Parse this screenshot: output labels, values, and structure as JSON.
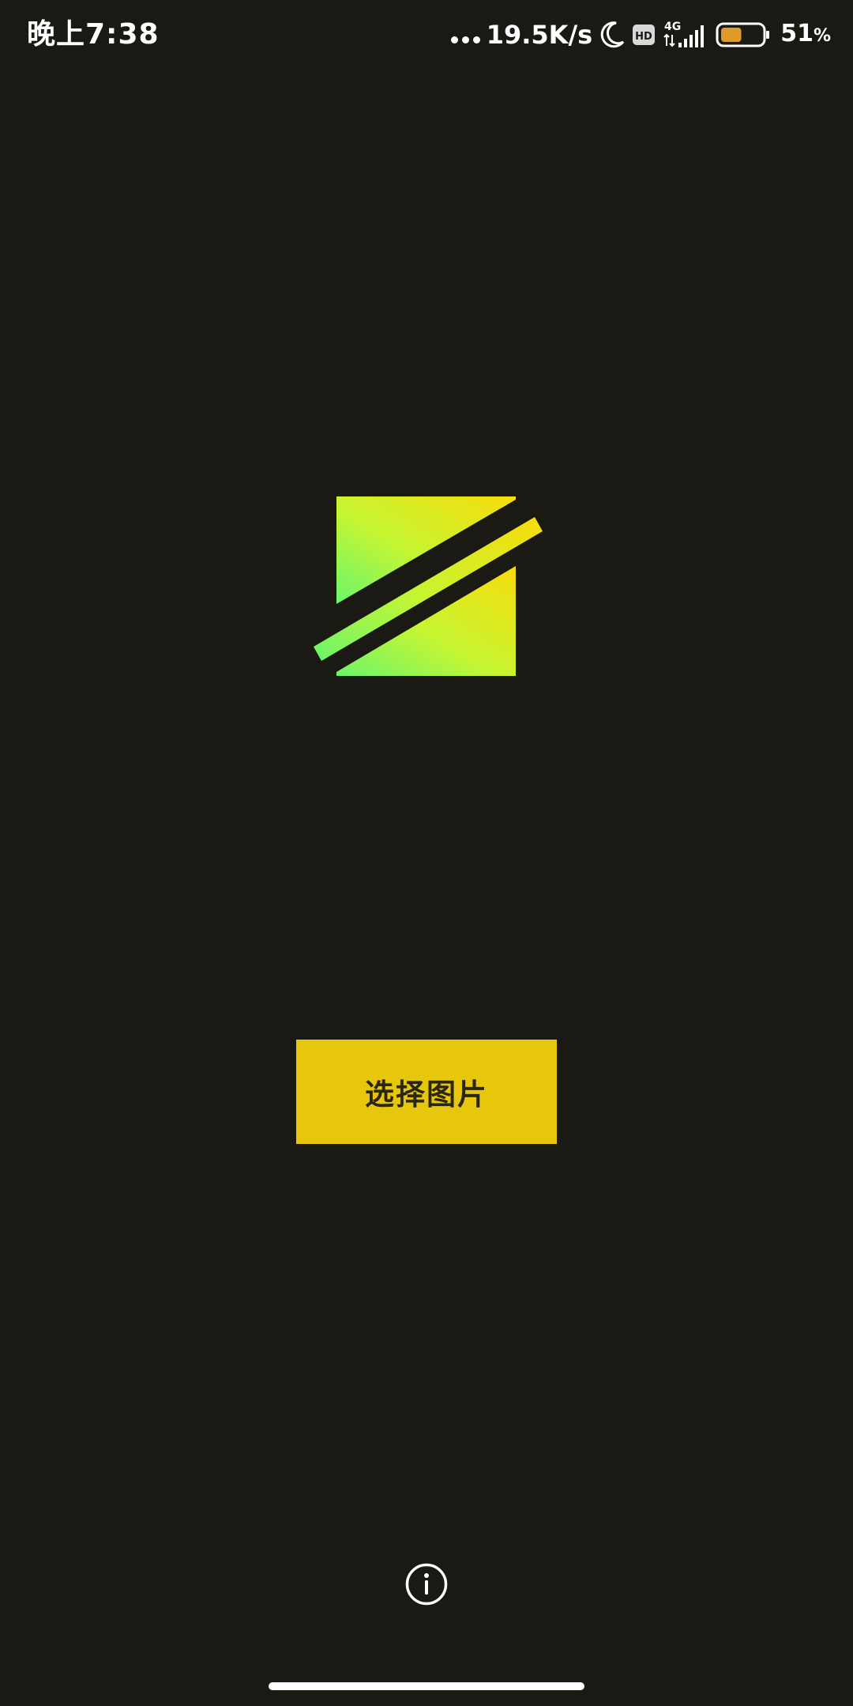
{
  "status_bar": {
    "time": "晚上7:38",
    "network_speed": "19.5K/s",
    "network_type": "4G",
    "hd_badge": "HD",
    "battery_percent": "51",
    "battery_symbol": "%",
    "battery_level": 0.51,
    "icons": [
      "moon-icon",
      "hd-icon",
      "signal-icon",
      "battery-icon"
    ]
  },
  "main": {
    "select_button_label": "选择图片",
    "info_icon": "info-icon"
  },
  "colors": {
    "background": "#1a1914",
    "button": "#e6c70b",
    "logo_gradient_start": "#6cf56c",
    "logo_gradient_end": "#f7dc0a"
  }
}
